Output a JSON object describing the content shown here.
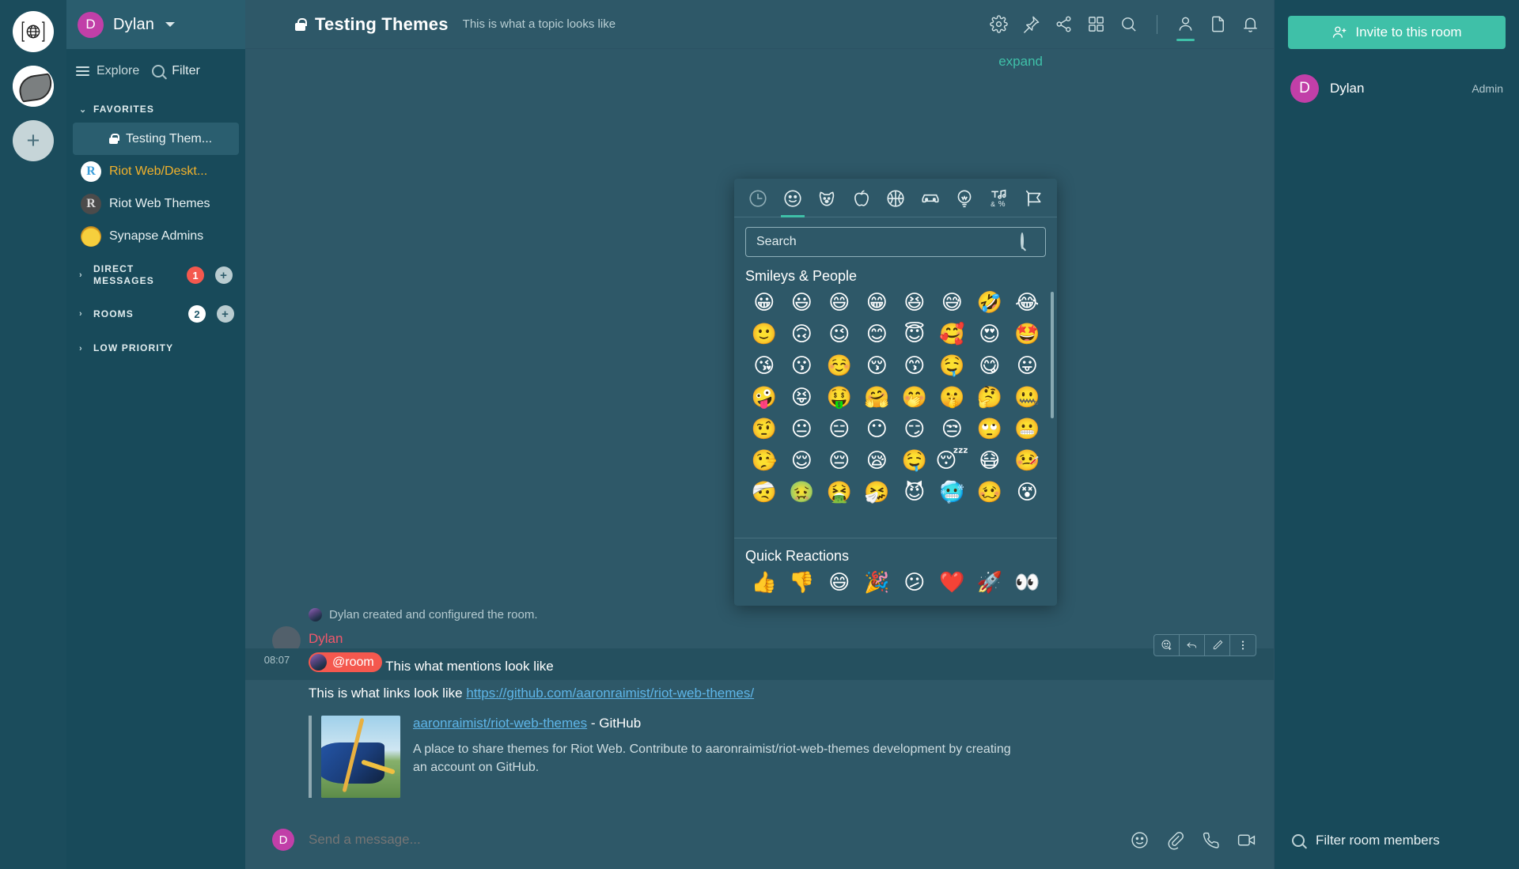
{
  "rail": {
    "items": [
      {
        "name": "home-space",
        "icon": "globe-icon"
      },
      {
        "name": "community-space",
        "icon": "blob-avatar"
      },
      {
        "name": "create-space",
        "icon": "plus-icon",
        "label": "+"
      }
    ]
  },
  "sidebar": {
    "user": {
      "initial": "D",
      "name": "Dylan"
    },
    "actions": {
      "explore_label": "Explore",
      "filter_label": "Filter"
    },
    "sections": [
      {
        "key": "favorites",
        "title": "FAVORITES",
        "expanded": true,
        "caret": "⌄",
        "rooms": [
          {
            "name": "Testing Them...",
            "selected": true,
            "locked": true,
            "unread": false,
            "avatar": "photo"
          },
          {
            "name": "Riot Web/Deskt...",
            "selected": false,
            "locked": false,
            "unread": true,
            "avatar": "riot-blue"
          },
          {
            "name": "Riot Web Themes",
            "selected": false,
            "locked": false,
            "unread": false,
            "avatar": "riot-grey"
          },
          {
            "name": "Synapse Admins",
            "selected": false,
            "locked": false,
            "unread": false,
            "avatar": "duck"
          }
        ]
      },
      {
        "key": "direct_messages",
        "title": "DIRECT MESSAGES",
        "expanded": false,
        "caret": "›",
        "badge": "1",
        "badge_style": "red",
        "add_label": "+"
      },
      {
        "key": "rooms",
        "title": "ROOMS",
        "expanded": false,
        "caret": "›",
        "badge": "2",
        "badge_style": "white",
        "add_label": "+"
      },
      {
        "key": "low_priority",
        "title": "LOW PRIORITY",
        "expanded": false,
        "caret": "›"
      }
    ]
  },
  "room_header": {
    "name": "Testing Themes",
    "topic": "This is what a topic looks like",
    "locked": true,
    "icons": [
      {
        "name": "room-settings-icon",
        "icon": "gear-icon",
        "active": false
      },
      {
        "name": "pinned-messages-icon",
        "icon": "pin-icon",
        "active": false
      },
      {
        "name": "share-room-icon",
        "icon": "share-icon",
        "active": false
      },
      {
        "name": "apps-icon",
        "icon": "grid-icon",
        "active": false
      },
      {
        "name": "search-room-icon",
        "icon": "search-icon",
        "active": false
      },
      {
        "name": "member-list-icon",
        "icon": "person-icon",
        "active": true
      },
      {
        "name": "files-icon",
        "icon": "file-icon",
        "active": false
      },
      {
        "name": "notifications-icon",
        "icon": "bell-icon",
        "active": false
      }
    ]
  },
  "timeline": {
    "created_event": "Dylan created and configured the room.",
    "expand_label": "expand",
    "message_group": {
      "sender": "Dylan",
      "timestamp": "08:07",
      "mention_pill": "@room",
      "mention_text": "This what mentions look like",
      "link_line_prefix": "This is what links look like ",
      "link_url": "https://github.com/aaronraimist/riot-web-themes/",
      "hover_tools": [
        {
          "name": "react-button",
          "icon": "emoji-plus-icon"
        },
        {
          "name": "reply-button",
          "icon": "reply-arrow-icon"
        },
        {
          "name": "edit-button",
          "icon": "pencil-icon"
        },
        {
          "name": "message-options-button",
          "icon": "overflow-dots-icon"
        }
      ]
    },
    "link_preview": {
      "title_link": "aaronraimist/riot-web-themes",
      "title_suffix": " - GitHub",
      "description": "A place to share themes for Riot Web. Contribute to aaronraimist/riot-web-themes development by creating an account on GitHub."
    }
  },
  "composer": {
    "avatar_initial": "D",
    "placeholder": "Send a message...",
    "icons": [
      {
        "name": "composer-emoji-icon",
        "icon": "emoji-icon"
      },
      {
        "name": "composer-attach-icon",
        "icon": "paperclip-icon"
      },
      {
        "name": "voice-call-icon",
        "icon": "phone-icon"
      },
      {
        "name": "video-call-icon",
        "icon": "video-icon"
      }
    ]
  },
  "right_panel": {
    "invite_label": "Invite to this room",
    "members": [
      {
        "initial": "D",
        "name": "Dylan",
        "role": "Admin"
      }
    ],
    "filter_placeholder": "Filter room members"
  },
  "emoji_picker": {
    "tabs": [
      {
        "name": "tab-recent",
        "icon": "clock-icon",
        "active": false,
        "dim": true
      },
      {
        "name": "tab-smileys-people",
        "icon": "smiley-icon",
        "active": true,
        "dim": false
      },
      {
        "name": "tab-animals-nature",
        "icon": "dog-icon",
        "active": false,
        "dim": false
      },
      {
        "name": "tab-food-drink",
        "icon": "apple-icon",
        "active": false,
        "dim": false
      },
      {
        "name": "tab-activity",
        "icon": "basketball-icon",
        "active": false,
        "dim": false
      },
      {
        "name": "tab-travel-places",
        "icon": "car-icon",
        "active": false,
        "dim": false
      },
      {
        "name": "tab-objects",
        "icon": "lightbulb-icon",
        "active": false,
        "dim": false
      },
      {
        "name": "tab-symbols",
        "icon": "symbols-icon",
        "active": false,
        "dim": false
      },
      {
        "name": "tab-flags",
        "icon": "flag-icon",
        "active": false,
        "dim": false
      }
    ],
    "search_placeholder": "Search",
    "category_title": "Smileys & People",
    "emojis": [
      "😀",
      "😃",
      "😄",
      "😁",
      "😆",
      "😅",
      "🤣",
      "😂",
      "🙂",
      "🙃",
      "😉",
      "😊",
      "😇",
      "🥰",
      "😍",
      "🤩",
      "😘",
      "😗",
      "☺️",
      "😚",
      "😙",
      "🤤",
      "😋",
      "😛",
      "🤪",
      "😝",
      "🤑",
      "🤗",
      "🤭",
      "🤫",
      "🤔",
      "🤐",
      "🤨",
      "😐",
      "😑",
      "😶",
      "😏",
      "😒",
      "🙄",
      "😬",
      "🤥",
      "😌",
      "😔",
      "😪",
      "🤤",
      "😴",
      "😷",
      "🤒",
      "🤕",
      "🤢",
      "🤮",
      "🤧",
      "😈",
      "🥶",
      "🥴",
      "😵"
    ],
    "quick_reactions_title": "Quick Reactions",
    "quick_reactions": [
      "👍",
      "👎",
      "😄",
      "🎉",
      "😕",
      "❤️",
      "🚀",
      "👀"
    ]
  },
  "colors": {
    "accent_green": "#3FC0A8",
    "accent_magenta": "#C13FA8",
    "mention_red": "#F4584E",
    "sender_pink": "#F2576B",
    "unread_yellow": "#F2B22B",
    "link_blue": "#5EB5E8",
    "bg_main": "#2E5868",
    "bg_sidebar": "#184A5A",
    "bg_rail": "#1B4C5C"
  }
}
